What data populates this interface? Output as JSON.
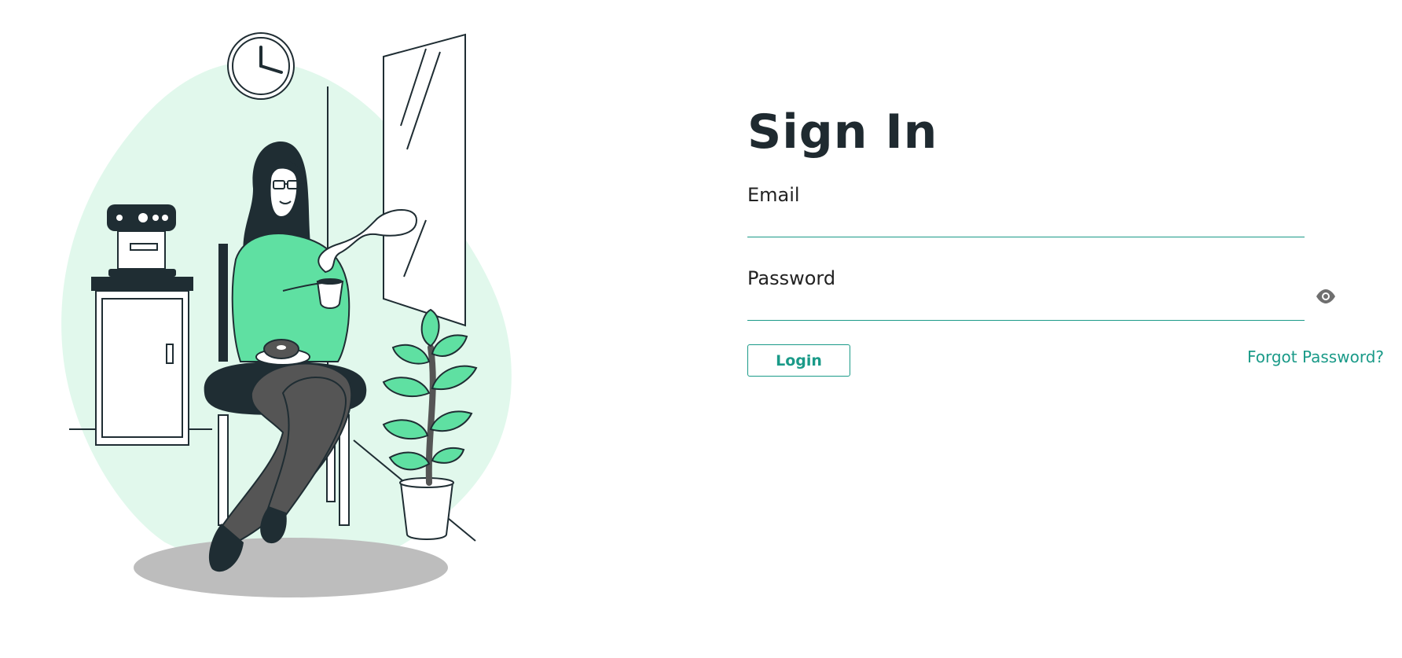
{
  "page": {
    "title": "Sign In"
  },
  "form": {
    "email": {
      "label": "Email",
      "value": "",
      "placeholder": ""
    },
    "password": {
      "label": "Password",
      "value": "",
      "placeholder": "",
      "toggle_icon": "eye-icon"
    },
    "login_label": "Login",
    "forgot_label": "Forgot Password?"
  },
  "illustration": {
    "icon": "woman-drinking-coffee-illustration"
  },
  "colors": {
    "accent": "#1a9a88",
    "blob": "#e1f8ec",
    "leaf": "#5fe0a2",
    "dark": "#1f2d33",
    "shadow": "#bdbdbd"
  }
}
